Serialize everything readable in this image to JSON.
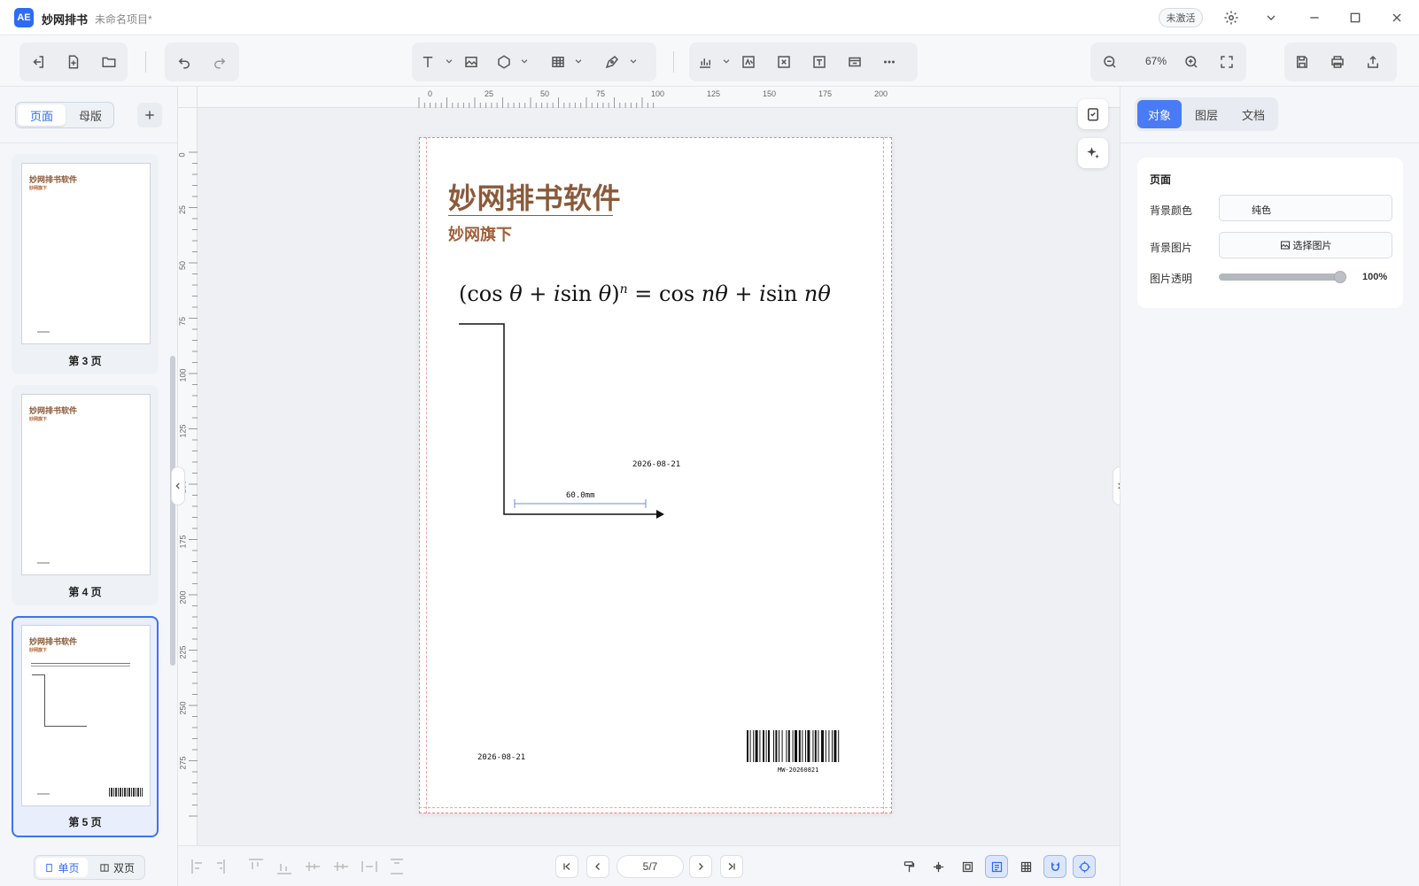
{
  "app": {
    "name": "妙网排书",
    "project": "未命名项目*",
    "status_badge": "未激活"
  },
  "toolbar": {
    "zoom": "67%"
  },
  "left_panel": {
    "tabs": [
      {
        "label": "页面",
        "active": true
      },
      {
        "label": "母版",
        "active": false
      }
    ],
    "pages": [
      {
        "label": "第 3 页",
        "selected": false,
        "title": "妙网排书软件",
        "subtitle": "妙网旗下"
      },
      {
        "label": "第 4 页",
        "selected": false,
        "title": "妙网排书软件",
        "subtitle": "妙网旗下"
      },
      {
        "label": "第 5 页",
        "selected": true,
        "title": "妙网排书软件",
        "subtitle": "妙网旗下"
      }
    ],
    "view_modes": [
      {
        "label": "单页",
        "active": true
      },
      {
        "label": "双页",
        "active": false
      }
    ]
  },
  "ruler": {
    "h_ticks": [
      "0",
      "25",
      "50",
      "75",
      "100",
      "125",
      "150",
      "175",
      "200"
    ],
    "v_ticks": [
      "0",
      "25",
      "50",
      "75",
      "100",
      "125",
      "150",
      "175",
      "200",
      "225",
      "250",
      "275"
    ]
  },
  "page": {
    "title": "妙网排书软件",
    "subtitle": "妙网旗下",
    "date_label": "2026-08-21",
    "dimension_label": "60.0mm",
    "footer_date": "2026-08-21",
    "barcode_text": "MW-20260821"
  },
  "bottom": {
    "page_indicator": "5/7"
  },
  "right_panel": {
    "tabs": [
      {
        "label": "对象",
        "active": true
      },
      {
        "label": "图层",
        "active": false
      },
      {
        "label": "文档",
        "active": false
      }
    ],
    "section_title": "页面",
    "bg_color_label": "背景颜色",
    "bg_color_value": "纯色",
    "bg_image_label": "背景图片",
    "bg_image_button": "选择图片",
    "opacity_label": "图片透明",
    "opacity_value": "100%",
    "opacity": 1.0
  },
  "colors": {
    "accent": "#4a7bf7",
    "brand_brown": "#8a5a3a",
    "margin_guide": "#f08080"
  }
}
